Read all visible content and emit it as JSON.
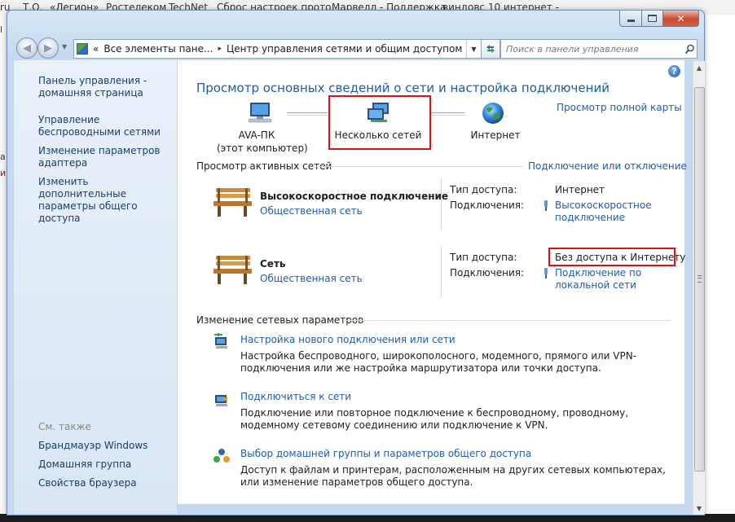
{
  "background": {
    "bookmarks": [
      "ru",
      "Т.О.",
      "«Легион»",
      "Ростелеком",
      "TechNet",
      "Сброс настроек прото",
      "Марвелл - Поддержка",
      "виндовс 10 интернет -"
    ],
    "left_fragments": [
      "l",
      "а",
      "и"
    ]
  },
  "navbar": {
    "address_segments": [
      "Все элементы пане...",
      "Центр управления сетями и общим доступом"
    ],
    "overflow_glyph": "«",
    "separator_glyph": "▸",
    "search_placeholder": "Поиск в панели управления"
  },
  "left_pane": {
    "links": [
      "Панель управления - домашняя страница",
      "Управление беспроводными сетями",
      "Изменение параметров адаптера",
      "Изменить дополнительные параметры общего доступа"
    ],
    "see_also_heading": "См. также",
    "see_also": [
      "Брандмауэр Windows",
      "Домашняя группа",
      "Свойства браузера"
    ]
  },
  "main": {
    "title": "Просмотр основных сведений о сети и настройка подключений",
    "map_link": "Просмотр полной карты",
    "map_nodes": {
      "computer_name": "AVA-ПК",
      "computer_sub": "(этот компьютер)",
      "networks": "Несколько сетей",
      "internet": "Интернет"
    },
    "active_heading": "Просмотр активных сетей",
    "connect_link": "Подключение или отключение",
    "networks": [
      {
        "name": "Высокоскоростное подключение",
        "type": "Общественная сеть",
        "access_label": "Тип доступа:",
        "access_value": "Интернет",
        "conn_label": "Подключения:",
        "conn_line1": "Высокоскоростное",
        "conn_line2": "подключение"
      },
      {
        "name": "Сеть",
        "type": "Общественная сеть",
        "access_label": "Тип доступа:",
        "access_value": "Без доступа к Интернету",
        "conn_label": "Подключения:",
        "conn_line1": "Подключение по",
        "conn_line2": "локальной сети"
      }
    ],
    "change_heading": "Изменение сетевых параметров",
    "tasks": [
      {
        "link": "Настройка нового подключения или сети",
        "desc": "Настройка беспроводного, широкополосного, модемного, прямого или VPN-подключения или же настройка маршрутизатора или точки доступа."
      },
      {
        "link": "Подключиться к сети",
        "desc": "Подключение или повторное подключение к беспроводному, проводному, модемному сетевому соединению или подключение к VPN."
      },
      {
        "link": "Выбор домашней группы и параметров общего доступа",
        "desc": "Доступ к файлам и принтерам, расположенным на других сетевых компьютерах, или изменение параметров общего доступа."
      }
    ],
    "help_glyph": "?"
  },
  "colors": {
    "link": "#1f5bb3",
    "title": "#1e5aa8",
    "highlight": "#e01010"
  }
}
